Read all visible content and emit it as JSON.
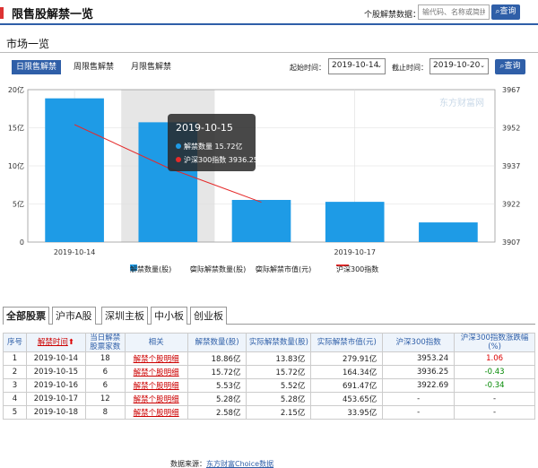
{
  "header": {
    "title": "限售股解禁一览",
    "search_label": "个股解禁数据：",
    "search_placeholder": "输代码、名称或简拼",
    "search_button": "查询"
  },
  "market": {
    "title": "市场一览",
    "tabs": [
      "日限售解禁",
      "周限售解禁",
      "月限售解禁"
    ],
    "start_label": "起始时间：",
    "start_value": "2019-10-14",
    "end_label": "截止时间：",
    "end_value": "2019-10-20",
    "query_button": "查询"
  },
  "colors": {
    "accent": "#2f5fa8",
    "bar": "#1e9be6",
    "line": "#e52a2a",
    "up": "#d00000",
    "down": "#008800"
  },
  "chart_data": {
    "type": "bar",
    "categories": [
      "2019-10-14",
      "2019-10-15",
      "2019-10-16",
      "2019-10-17",
      "2019-10-18"
    ],
    "x_tick_labels": [
      "2019-10-14",
      "2019-10-17"
    ],
    "series": [
      {
        "name": "解禁数量(股)",
        "type": "bar",
        "axis": "left",
        "values": [
          18.86,
          15.72,
          5.53,
          5.28,
          2.58
        ],
        "unit": "亿"
      },
      {
        "name": "沪深300指数",
        "type": "line",
        "axis": "right",
        "values": [
          3953.24,
          3936.25,
          3922.69,
          null,
          null
        ]
      }
    ],
    "left_axis": {
      "ylim": [
        0,
        20
      ],
      "ticks": [
        "0",
        "5亿",
        "10亿",
        "15亿",
        "20亿"
      ]
    },
    "right_axis": {
      "ylim": [
        3907,
        3967
      ],
      "ticks": [
        "3907",
        "3922",
        "3937",
        "3952",
        "3967"
      ]
    },
    "highlighted_category": "2019-10-15",
    "tooltip": {
      "date": "2019-10-15",
      "rows": [
        "解禁数量 15.72亿",
        "沪深300指数 3936.25"
      ]
    },
    "watermark": "东方财富网",
    "legend": [
      "解禁数量(股)",
      "实际解禁数量(股)",
      "实际解禁市值(元)",
      "沪深300指数"
    ],
    "grid": true
  },
  "table_tabs": [
    "全部股票",
    "沪市A股",
    "深圳主板",
    "中小板",
    "创业板"
  ],
  "table": {
    "headers": [
      "序号",
      "解禁时间",
      "当日解禁股票家数",
      "相关",
      "解禁数量(股)",
      "实际解禁数量(股)",
      "实际解禁市值(元)",
      "沪深300指数",
      "沪深300指数涨跌幅(%)"
    ],
    "rows": [
      {
        "idx": "1",
        "date": "2019-10-14",
        "count": "18",
        "link": "解禁个股明细",
        "qty": "18.86亿",
        "actual_qty": "13.83亿",
        "actual_val": "279.91亿",
        "index": "3953.24",
        "change": "1.06",
        "dir": "up"
      },
      {
        "idx": "2",
        "date": "2019-10-15",
        "count": "6",
        "link": "解禁个股明细",
        "qty": "15.72亿",
        "actual_qty": "15.72亿",
        "actual_val": "164.34亿",
        "index": "3936.25",
        "change": "-0.43",
        "dir": "down"
      },
      {
        "idx": "3",
        "date": "2019-10-16",
        "count": "6",
        "link": "解禁个股明细",
        "qty": "5.53亿",
        "actual_qty": "5.52亿",
        "actual_val": "691.47亿",
        "index": "3922.69",
        "change": "-0.34",
        "dir": "down"
      },
      {
        "idx": "4",
        "date": "2019-10-17",
        "count": "12",
        "link": "解禁个股明细",
        "qty": "5.28亿",
        "actual_qty": "5.28亿",
        "actual_val": "453.65亿",
        "index": "-",
        "change": "-",
        "dir": ""
      },
      {
        "idx": "5",
        "date": "2019-10-18",
        "count": "8",
        "link": "解禁个股明细",
        "qty": "2.58亿",
        "actual_qty": "2.15亿",
        "actual_val": "33.95亿",
        "index": "-",
        "change": "-",
        "dir": ""
      }
    ]
  },
  "footer": {
    "label": "数据来源：",
    "link": "东方财富Choice数据"
  }
}
